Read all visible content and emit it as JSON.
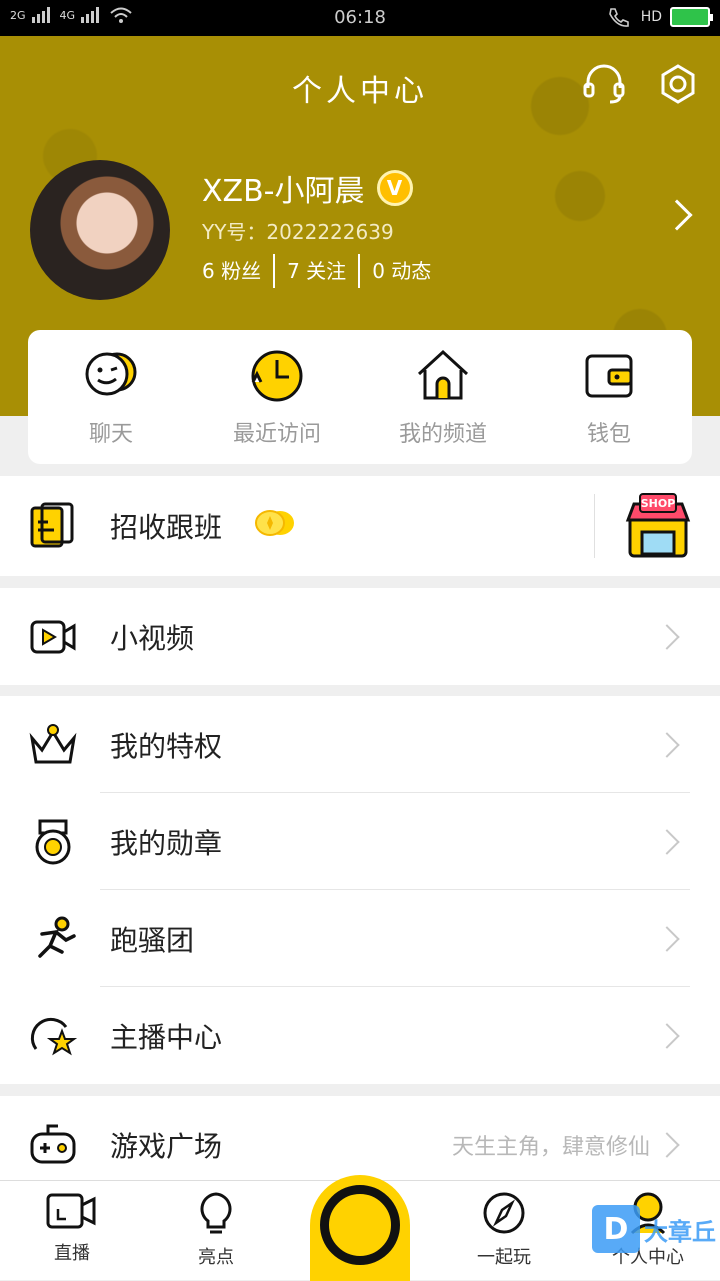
{
  "status": {
    "signal_left": "2G",
    "signal_right": "4G",
    "time": "06:18",
    "hd": "HD"
  },
  "header": {
    "title": "个人中心",
    "username": "XZB-小阿晨",
    "badge": "V",
    "yy_label": "YY号：2022222639",
    "fans": "6 粉丝",
    "follows": "7 关注",
    "posts": "0 动态"
  },
  "quick": [
    {
      "label": "聊天"
    },
    {
      "label": "最近访问"
    },
    {
      "label": "我的频道"
    },
    {
      "label": "钱包"
    }
  ],
  "promo": {
    "label": "招收跟班",
    "shop_text": "SHOP"
  },
  "menu1": [
    {
      "label": "小视频"
    }
  ],
  "menu2": [
    {
      "label": "我的特权"
    },
    {
      "label": "我的勋章"
    },
    {
      "label": "跑骚团"
    },
    {
      "label": "主播中心"
    }
  ],
  "menu3": [
    {
      "label": "游戏广场",
      "extra": "天生主角，肆意修仙"
    }
  ],
  "tabs": {
    "live": "直播",
    "highlights": "亮点",
    "play": "一起玩",
    "me": "个人中心"
  },
  "watermark": {
    "logo": "D",
    "text": "大章丘"
  },
  "colors": {
    "header_bg": "#a88f05",
    "accent": "#ffd200"
  }
}
